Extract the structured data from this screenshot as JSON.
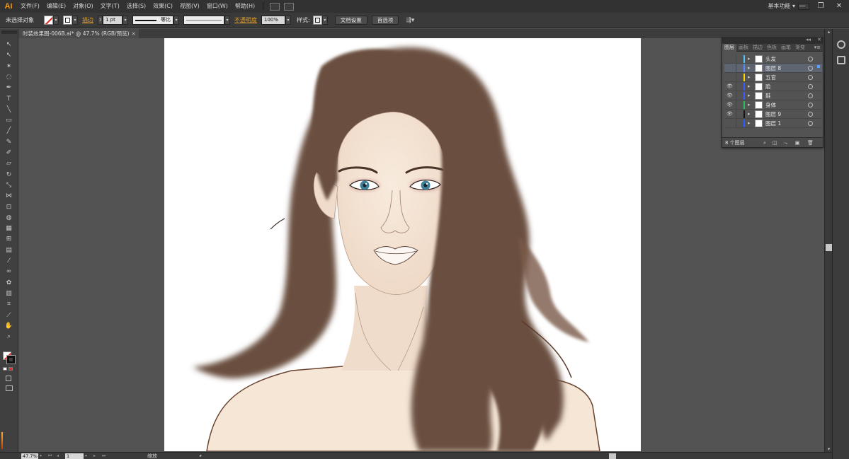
{
  "app": {
    "logo": "Ai",
    "menu": [
      "文件(F)",
      "编辑(E)",
      "对象(O)",
      "文字(T)",
      "选择(S)",
      "效果(C)",
      "视图(V)",
      "窗口(W)",
      "帮助(H)"
    ],
    "workspace": "基本功能",
    "workspace_arrow": "▾",
    "window_controls": {
      "minimize": "—",
      "restore": "❐",
      "close": "✕"
    }
  },
  "control_bar": {
    "selection_status": "未选择对象",
    "stroke_label": "描边",
    "stroke_weight": "1 pt",
    "stroke_profile": "等比",
    "opacity_label": "不透明度",
    "opacity_value": "100%",
    "style_label": "样式:",
    "doc_setup_button": "文档设置",
    "preferences_button": "首选项",
    "accent_color": "#e0a030"
  },
  "document": {
    "tab_title": "时装效果图-006B.ai* @ 47.7% (RGB/预览)",
    "close": "×"
  },
  "tools": [
    {
      "name": "selection-tool-icon",
      "glyph": "↖"
    },
    {
      "name": "direct-selection-tool-icon",
      "glyph": "↖"
    },
    {
      "name": "magic-wand-tool-icon",
      "glyph": "✶"
    },
    {
      "name": "lasso-tool-icon",
      "glyph": "◌"
    },
    {
      "name": "pen-tool-icon",
      "glyph": "✒"
    },
    {
      "name": "type-tool-icon",
      "glyph": "T"
    },
    {
      "name": "line-tool-icon",
      "glyph": "╲"
    },
    {
      "name": "rectangle-tool-icon",
      "glyph": "▭"
    },
    {
      "name": "paintbrush-tool-icon",
      "glyph": "╱"
    },
    {
      "name": "pencil-tool-icon",
      "glyph": "✎"
    },
    {
      "name": "blob-brush-tool-icon",
      "glyph": "✐"
    },
    {
      "name": "eraser-tool-icon",
      "glyph": "▱"
    },
    {
      "name": "rotate-tool-icon",
      "glyph": "↻"
    },
    {
      "name": "scale-tool-icon",
      "glyph": "⤡"
    },
    {
      "name": "width-tool-icon",
      "glyph": "⋈"
    },
    {
      "name": "free-transform-tool-icon",
      "glyph": "⊡"
    },
    {
      "name": "shape-builder-tool-icon",
      "glyph": "◍"
    },
    {
      "name": "perspective-grid-tool-icon",
      "glyph": "▦"
    },
    {
      "name": "mesh-tool-icon",
      "glyph": "⊞"
    },
    {
      "name": "gradient-tool-icon",
      "glyph": "▤"
    },
    {
      "name": "eyedropper-tool-icon",
      "glyph": "⁄"
    },
    {
      "name": "blend-tool-icon",
      "glyph": "∞"
    },
    {
      "name": "symbol-sprayer-tool-icon",
      "glyph": "✿"
    },
    {
      "name": "column-graph-tool-icon",
      "glyph": "▥"
    },
    {
      "name": "artboard-tool-icon",
      "glyph": "⌗"
    },
    {
      "name": "slice-tool-icon",
      "glyph": "⟋"
    },
    {
      "name": "hand-tool-icon",
      "glyph": "✋"
    },
    {
      "name": "zoom-tool-icon",
      "glyph": "⌕"
    }
  ],
  "layers_panel": {
    "tabs": [
      "图层",
      "画板",
      "描边",
      "色板",
      "画笔",
      "渐变"
    ],
    "active_tab": "图层",
    "menu_glyph": "▾≡",
    "collapse_glyph": "◂◂",
    "close_glyph": "✕",
    "layers": [
      {
        "name": "头发",
        "visible": false,
        "color": "#4fc3f7",
        "selected": false
      },
      {
        "name": "图层 8",
        "visible": false,
        "color": "#5a8cff",
        "selected": true
      },
      {
        "name": "五官",
        "visible": false,
        "color": "#ffd400",
        "selected": false
      },
      {
        "name": "脸",
        "visible": true,
        "color": "#3d5afe",
        "selected": false
      },
      {
        "name": "鞋",
        "visible": true,
        "color": "#3d5afe",
        "selected": false
      },
      {
        "name": "身体",
        "visible": true,
        "color": "#22c55e",
        "selected": false
      },
      {
        "name": "图层 9",
        "visible": true,
        "color": "#111111",
        "selected": false
      },
      {
        "name": "图层 1",
        "visible": false,
        "color": "#2a5cff",
        "selected": false
      }
    ],
    "footer_count": "8 个图层",
    "eye_glyph": "👁",
    "expand_glyph": "▸"
  },
  "status_bar": {
    "zoom": "47.7%",
    "artboard_number": "1",
    "tool_label": "缩放",
    "nav_first": "⏮",
    "nav_prev": "◂",
    "nav_next": "▸",
    "nav_last": "⏭"
  },
  "artwork": {
    "hair_color": "#6b4f41",
    "skin_color": "#f6e7d8",
    "eye_color": "#3f7f9a"
  }
}
